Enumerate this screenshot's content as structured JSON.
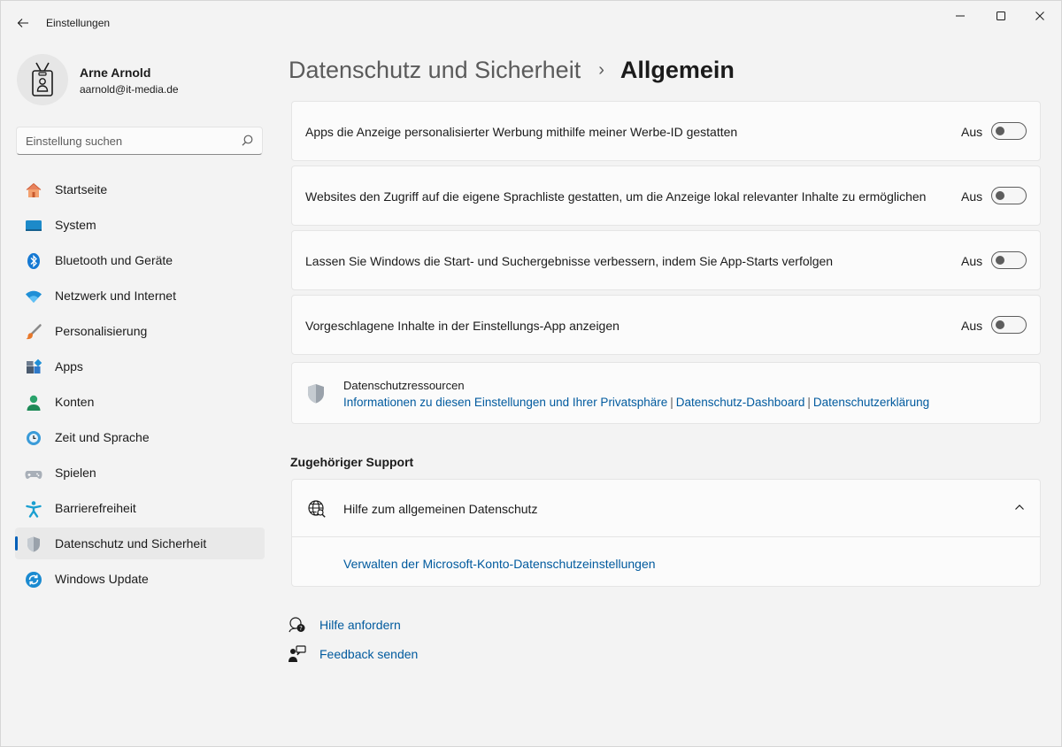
{
  "window": {
    "title": "Einstellungen"
  },
  "user": {
    "name": "Arne Arnold",
    "email": "aarnold@it-media.de"
  },
  "search": {
    "placeholder": "Einstellung suchen"
  },
  "sidebar": {
    "items": [
      {
        "label": "Startseite",
        "icon": "home-icon"
      },
      {
        "label": "System",
        "icon": "system-icon"
      },
      {
        "label": "Bluetooth und Geräte",
        "icon": "bluetooth-icon"
      },
      {
        "label": "Netzwerk und Internet",
        "icon": "wifi-icon"
      },
      {
        "label": "Personalisierung",
        "icon": "brush-icon"
      },
      {
        "label": "Apps",
        "icon": "apps-icon"
      },
      {
        "label": "Konten",
        "icon": "account-icon"
      },
      {
        "label": "Zeit und Sprache",
        "icon": "clock-globe-icon"
      },
      {
        "label": "Spielen",
        "icon": "gamepad-icon"
      },
      {
        "label": "Barrierefreiheit",
        "icon": "accessibility-icon"
      },
      {
        "label": "Datenschutz und Sicherheit",
        "icon": "shield-icon",
        "active": true
      },
      {
        "label": "Windows Update",
        "icon": "update-icon"
      }
    ]
  },
  "header": {
    "parent": "Datenschutz und Sicherheit",
    "separator": "›",
    "current": "Allgemein"
  },
  "settings": [
    {
      "label": "Apps die Anzeige personalisierter Werbung mithilfe meiner Werbe-ID gestatten",
      "state": "Aus",
      "on": false
    },
    {
      "label": "Websites den Zugriff auf die eigene Sprachliste gestatten, um die Anzeige lokal relevanter Inhalte zu ermöglichen",
      "state": "Aus",
      "on": false
    },
    {
      "label": "Lassen Sie Windows die Start- und Suchergebnisse verbessern, indem Sie App-Starts verfolgen",
      "state": "Aus",
      "on": false
    },
    {
      "label": "Vorgeschlagene Inhalte in der Einstellungs-App anzeigen",
      "state": "Aus",
      "on": false
    }
  ],
  "resources": {
    "title": "Datenschutzressourcen",
    "links": [
      "Informationen zu diesen Einstellungen und Ihrer Privatsphäre",
      "Datenschutz-Dashboard",
      "Datenschutzerklärung"
    ],
    "separator": "|"
  },
  "support": {
    "section_title": "Zugehöriger Support",
    "item_title": "Hilfe zum allgemeinen Datenschutz",
    "link": "Verwalten der Microsoft-Konto-Datenschutzeinstellungen"
  },
  "footer": {
    "help": "Hilfe anfordern",
    "feedback": "Feedback senden"
  },
  "colors": {
    "accent": "#005fb8",
    "link": "#005a9e",
    "background": "#f3f3f3",
    "card": "#fbfbfb"
  }
}
